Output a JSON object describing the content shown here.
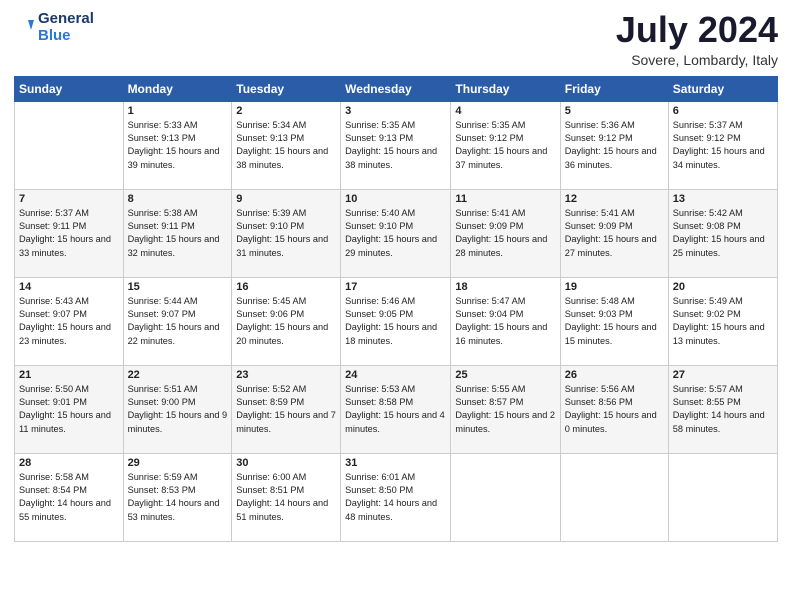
{
  "header": {
    "logo_line1": "General",
    "logo_line2": "Blue",
    "month_title": "July 2024",
    "subtitle": "Sovere, Lombardy, Italy"
  },
  "days_of_week": [
    "Sunday",
    "Monday",
    "Tuesday",
    "Wednesday",
    "Thursday",
    "Friday",
    "Saturday"
  ],
  "weeks": [
    [
      {
        "day": "",
        "info": ""
      },
      {
        "day": "1",
        "info": "Sunrise: 5:33 AM\nSunset: 9:13 PM\nDaylight: 15 hours\nand 39 minutes."
      },
      {
        "day": "2",
        "info": "Sunrise: 5:34 AM\nSunset: 9:13 PM\nDaylight: 15 hours\nand 38 minutes."
      },
      {
        "day": "3",
        "info": "Sunrise: 5:35 AM\nSunset: 9:13 PM\nDaylight: 15 hours\nand 38 minutes."
      },
      {
        "day": "4",
        "info": "Sunrise: 5:35 AM\nSunset: 9:12 PM\nDaylight: 15 hours\nand 37 minutes."
      },
      {
        "day": "5",
        "info": "Sunrise: 5:36 AM\nSunset: 9:12 PM\nDaylight: 15 hours\nand 36 minutes."
      },
      {
        "day": "6",
        "info": "Sunrise: 5:37 AM\nSunset: 9:12 PM\nDaylight: 15 hours\nand 34 minutes."
      }
    ],
    [
      {
        "day": "7",
        "info": "Sunrise: 5:37 AM\nSunset: 9:11 PM\nDaylight: 15 hours\nand 33 minutes."
      },
      {
        "day": "8",
        "info": "Sunrise: 5:38 AM\nSunset: 9:11 PM\nDaylight: 15 hours\nand 32 minutes."
      },
      {
        "day": "9",
        "info": "Sunrise: 5:39 AM\nSunset: 9:10 PM\nDaylight: 15 hours\nand 31 minutes."
      },
      {
        "day": "10",
        "info": "Sunrise: 5:40 AM\nSunset: 9:10 PM\nDaylight: 15 hours\nand 29 minutes."
      },
      {
        "day": "11",
        "info": "Sunrise: 5:41 AM\nSunset: 9:09 PM\nDaylight: 15 hours\nand 28 minutes."
      },
      {
        "day": "12",
        "info": "Sunrise: 5:41 AM\nSunset: 9:09 PM\nDaylight: 15 hours\nand 27 minutes."
      },
      {
        "day": "13",
        "info": "Sunrise: 5:42 AM\nSunset: 9:08 PM\nDaylight: 15 hours\nand 25 minutes."
      }
    ],
    [
      {
        "day": "14",
        "info": "Sunrise: 5:43 AM\nSunset: 9:07 PM\nDaylight: 15 hours\nand 23 minutes."
      },
      {
        "day": "15",
        "info": "Sunrise: 5:44 AM\nSunset: 9:07 PM\nDaylight: 15 hours\nand 22 minutes."
      },
      {
        "day": "16",
        "info": "Sunrise: 5:45 AM\nSunset: 9:06 PM\nDaylight: 15 hours\nand 20 minutes."
      },
      {
        "day": "17",
        "info": "Sunrise: 5:46 AM\nSunset: 9:05 PM\nDaylight: 15 hours\nand 18 minutes."
      },
      {
        "day": "18",
        "info": "Sunrise: 5:47 AM\nSunset: 9:04 PM\nDaylight: 15 hours\nand 16 minutes."
      },
      {
        "day": "19",
        "info": "Sunrise: 5:48 AM\nSunset: 9:03 PM\nDaylight: 15 hours\nand 15 minutes."
      },
      {
        "day": "20",
        "info": "Sunrise: 5:49 AM\nSunset: 9:02 PM\nDaylight: 15 hours\nand 13 minutes."
      }
    ],
    [
      {
        "day": "21",
        "info": "Sunrise: 5:50 AM\nSunset: 9:01 PM\nDaylight: 15 hours\nand 11 minutes."
      },
      {
        "day": "22",
        "info": "Sunrise: 5:51 AM\nSunset: 9:00 PM\nDaylight: 15 hours\nand 9 minutes."
      },
      {
        "day": "23",
        "info": "Sunrise: 5:52 AM\nSunset: 8:59 PM\nDaylight: 15 hours\nand 7 minutes."
      },
      {
        "day": "24",
        "info": "Sunrise: 5:53 AM\nSunset: 8:58 PM\nDaylight: 15 hours\nand 4 minutes."
      },
      {
        "day": "25",
        "info": "Sunrise: 5:55 AM\nSunset: 8:57 PM\nDaylight: 15 hours\nand 2 minutes."
      },
      {
        "day": "26",
        "info": "Sunrise: 5:56 AM\nSunset: 8:56 PM\nDaylight: 15 hours\nand 0 minutes."
      },
      {
        "day": "27",
        "info": "Sunrise: 5:57 AM\nSunset: 8:55 PM\nDaylight: 14 hours\nand 58 minutes."
      }
    ],
    [
      {
        "day": "28",
        "info": "Sunrise: 5:58 AM\nSunset: 8:54 PM\nDaylight: 14 hours\nand 55 minutes."
      },
      {
        "day": "29",
        "info": "Sunrise: 5:59 AM\nSunset: 8:53 PM\nDaylight: 14 hours\nand 53 minutes."
      },
      {
        "day": "30",
        "info": "Sunrise: 6:00 AM\nSunset: 8:51 PM\nDaylight: 14 hours\nand 51 minutes."
      },
      {
        "day": "31",
        "info": "Sunrise: 6:01 AM\nSunset: 8:50 PM\nDaylight: 14 hours\nand 48 minutes."
      },
      {
        "day": "",
        "info": ""
      },
      {
        "day": "",
        "info": ""
      },
      {
        "day": "",
        "info": ""
      }
    ]
  ]
}
